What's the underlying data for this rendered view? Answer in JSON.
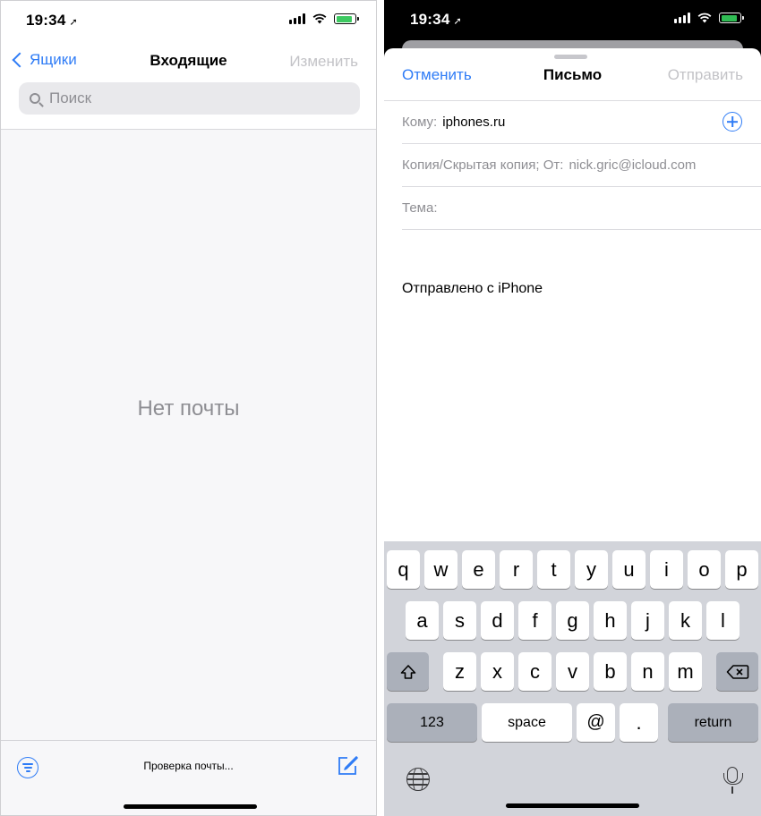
{
  "left": {
    "status": {
      "time": "19:34"
    },
    "nav": {
      "back_label": "Ящики",
      "title": "Входящие",
      "edit_label": "Изменить"
    },
    "search": {
      "placeholder": "Поиск"
    },
    "empty_message": "Нет почты",
    "toolbar": {
      "status_text": "Проверка почты..."
    }
  },
  "right": {
    "status": {
      "time": "19:34"
    },
    "compose": {
      "cancel_label": "Отменить",
      "title": "Письмо",
      "send_label": "Отправить",
      "to_label": "Кому:",
      "to_value": "iphones.ru",
      "cc_label": "Копия/Скрытая копия; От:",
      "cc_value": "nick.gric@icloud.com",
      "subject_label": "Тема:",
      "body_text": "Отправлено с iPhone"
    },
    "keyboard": {
      "row1": [
        "q",
        "w",
        "e",
        "r",
        "t",
        "y",
        "u",
        "i",
        "o",
        "p"
      ],
      "row2": [
        "a",
        "s",
        "d",
        "f",
        "g",
        "h",
        "j",
        "k",
        "l"
      ],
      "row3": [
        "z",
        "x",
        "c",
        "v",
        "b",
        "n",
        "m"
      ],
      "numbers_label": "123",
      "space_label": "space",
      "at_label": "@",
      "dot_label": ".",
      "return_label": "return"
    }
  },
  "colors": {
    "accent": "#2f7cf6",
    "disabled": "#c3c3c7",
    "battery": "#33c759"
  }
}
